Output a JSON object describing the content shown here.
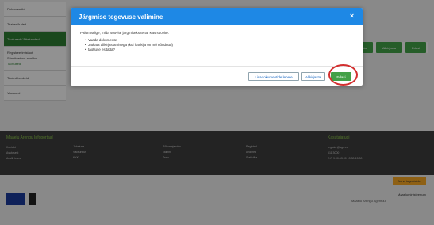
{
  "sidebar": {
    "items": [
      {
        "label": "Dokumendid"
      },
      {
        "label": "Teabenõuded"
      },
      {
        "label": "Taotlused / Ettekanded"
      }
    ],
    "sub_items": [
      "Registreerimistaotl",
      "Sünnitoetuse avaldus",
      "Taotlused"
    ],
    "items_lower": [
      "Teated hankeid",
      "Vastused"
    ]
  },
  "background_buttons": [
    "Salvesta",
    "Allkirjasta",
    "Edasi"
  ],
  "footer": {
    "col1_title": "Maaelu Arengu Infoportaal",
    "col1": [
      "Kontakt",
      "Asutusest",
      "Avalik teave"
    ],
    "col2": [
      "Juhatuse",
      "Välisuhtlus",
      "KKK"
    ],
    "col3": [
      "Põllumajandus",
      "Tallinn",
      "Tartu"
    ],
    "col4": [
      "Registrid",
      "Andmed",
      "Statistika"
    ],
    "col5_title": "Kasutajatugi",
    "col5": [
      "register@agri.ee",
      "611 3000",
      "E-R 9:00-13:00 13:30-15:30"
    ]
  },
  "feedback_label": "Anna tagasisidet",
  "agency_text": "Maaelu Arengu Agentuur",
  "agency_logo_text": "Maaeluministeerium",
  "modal": {
    "title": "Järgmise tegevuse valimine",
    "close": "×",
    "question": "Palun valige, mida soovite järgmiseks teha. Kas soovite:",
    "options": [
      "Vaada dokumente",
      "Jätkata allkirjastamisega (kui hankija on mõ nõudnud)",
      "taotluse esitada?"
    ],
    "buttons": {
      "add_documents": "Lisadokumentide lehele",
      "sign": "Allkirjasta",
      "next": "Edasi"
    }
  },
  "colors": {
    "header_blue": "#1e88e5",
    "primary_green": "#43a047",
    "highlight_red": "#d32f2f"
  }
}
